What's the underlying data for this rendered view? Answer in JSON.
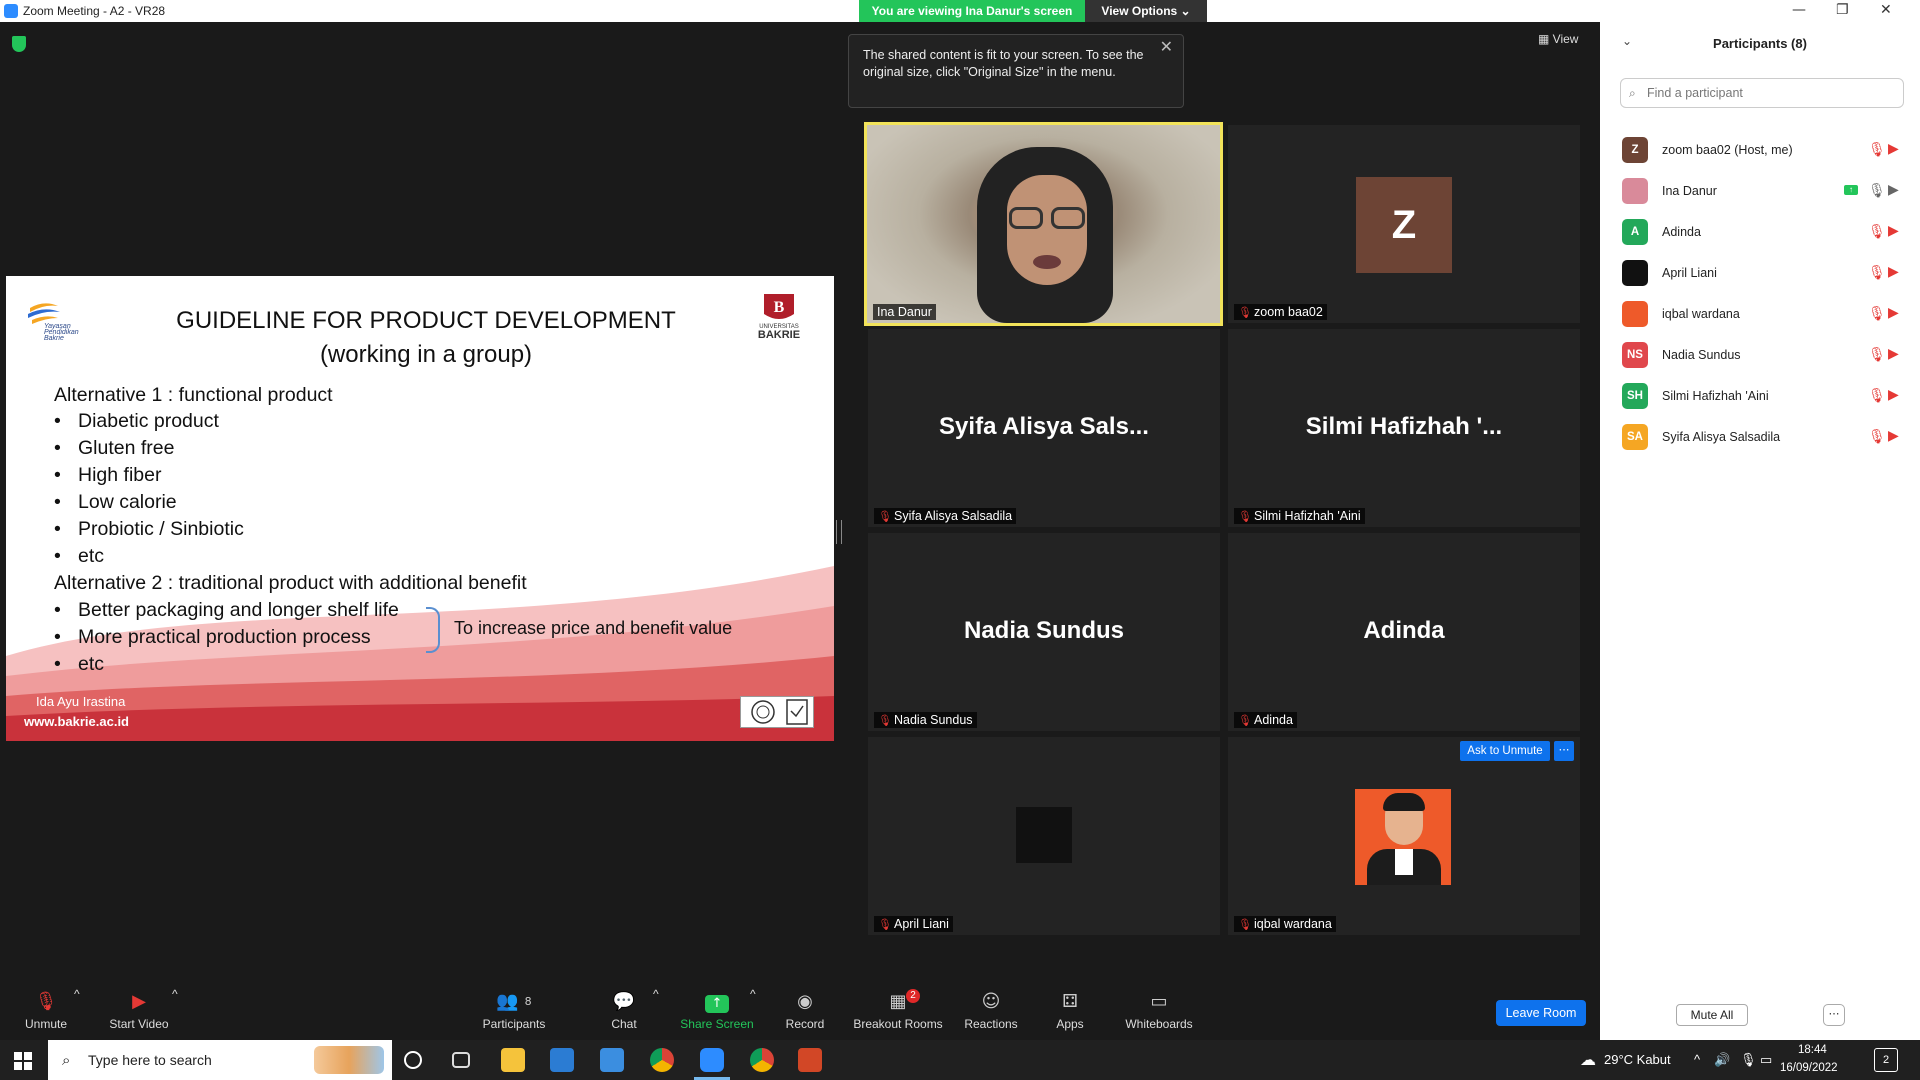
{
  "window": {
    "title": "Zoom Meeting - A2 - VR28"
  },
  "window_controls": {
    "minimize": "—",
    "restore": "❐",
    "close": "✕"
  },
  "banner": {
    "viewing": "You are viewing Ina Danur's screen",
    "view_options": "View Options ⌄"
  },
  "view_button": "View",
  "tooltip": {
    "text": "The shared content is fit to your screen. To see the original size, click \"Original Size\" in the menu.",
    "close": "✕"
  },
  "slide": {
    "title_line1": "GUIDELINE FOR PRODUCT DEVELOPMENT",
    "title_line2": "(working in a group)",
    "alt1": "Alternative 1     : functional product",
    "alt1_items": [
      "Diabetic product",
      "Gluten free",
      "High fiber",
      "Low calorie",
      "Probiotic / Sinbiotic",
      "etc"
    ],
    "alt2": "Alternative 2     : traditional product with additional benefit",
    "alt2_items": [
      "Better packaging and longer shelf life",
      "More practical production process",
      "etc"
    ],
    "benefit": "To increase price and benefit value",
    "author": "Ida Ayu Irastina",
    "website": "www.bakrie.ac.id",
    "logo_left": "Yayasan Pendidikan Bakrie",
    "logo_right": "UNIVERSITAS BAKRIE"
  },
  "tiles": [
    {
      "name": "Ina Danur",
      "big": "",
      "muted": false
    },
    {
      "name": "zoom baa02",
      "big": "Z",
      "muted": true
    },
    {
      "name": "Syifa Alisya Salsadila",
      "big": "Syifa Alisya Sals...",
      "muted": true
    },
    {
      "name": "Silmi Hafizhah 'Aini",
      "big": "Silmi Hafizhah '...",
      "muted": true
    },
    {
      "name": "Nadia Sundus",
      "big": "Nadia Sundus",
      "muted": true
    },
    {
      "name": "Adinda",
      "big": "Adinda",
      "muted": true
    },
    {
      "name": "April Liani",
      "big": "",
      "muted": true
    },
    {
      "name": "iqbal wardana",
      "big": "",
      "muted": true
    }
  ],
  "ask_to_unmute": "Ask to Unmute",
  "more_dots": "⋯",
  "toolbar": {
    "unmute": "Unmute",
    "start_video": "Start Video",
    "participants": "Participants",
    "participants_count": "8",
    "chat": "Chat",
    "share_screen": "Share Screen",
    "record": "Record",
    "breakout_rooms": "Breakout Rooms",
    "breakout_count": "2",
    "reactions": "Reactions",
    "apps": "Apps",
    "whiteboards": "Whiteboards",
    "leave": "Leave Room"
  },
  "panel": {
    "title": "Participants (8)",
    "search_placeholder": "Find a participant",
    "participants": [
      {
        "initials": "Z",
        "name": "zoom baa02 (Host, me)",
        "color": "#6d4435"
      },
      {
        "initials": "",
        "name": "Ina Danur",
        "color": "#d98a9a"
      },
      {
        "initials": "A",
        "name": "Adinda",
        "color": "#23a85a"
      },
      {
        "initials": "",
        "name": "April Liani",
        "color": "#111111"
      },
      {
        "initials": "",
        "name": "iqbal wardana",
        "color": "#ee5a2a"
      },
      {
        "initials": "NS",
        "name": "Nadia Sundus",
        "color": "#e0474c"
      },
      {
        "initials": "SH",
        "name": "Silmi Hafizhah 'Aini",
        "color": "#23a85a"
      },
      {
        "initials": "SA",
        "name": "Syifa Alisya Salsadila",
        "color": "#f5a623"
      }
    ],
    "mute_all": "Mute All",
    "more": "⋯"
  },
  "taskbar": {
    "search_placeholder": "Type here to search",
    "weather": "29°C  Kabut",
    "time": "18:44",
    "date": "16/09/2022",
    "notifications": "2"
  },
  "colors": {
    "accent": "#0e72ed",
    "green": "#23c55a",
    "muted_red": "#e53935",
    "active_border": "#f2e35a"
  }
}
